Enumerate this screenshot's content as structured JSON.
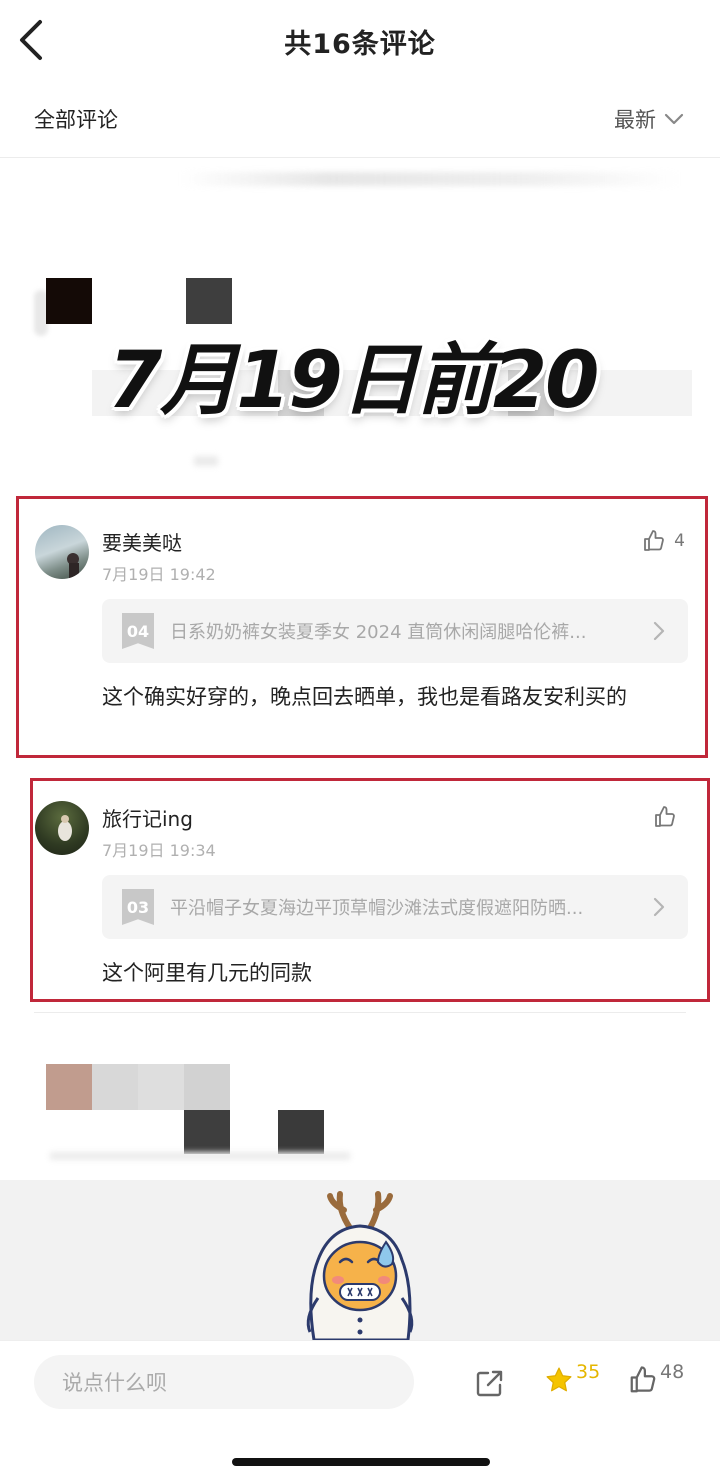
{
  "header": {
    "title": "共16条评论",
    "filter_label": "全部评论",
    "sort_label": "最新"
  },
  "overlay_stamp": "7月19日前20",
  "comments": [
    {
      "username": "要美美哒",
      "time": "7月19日 19:42",
      "likes": "4",
      "product_no": "04",
      "product_name": "日系奶奶裤女装夏季女 2024 直筒休闲阔腿哈伦裤...",
      "text": "这个确实好穿的，晚点回去晒单，我也是看路友安利买的"
    },
    {
      "username": "旅行记ing",
      "time": "7月19日 19:34",
      "likes": "",
      "product_no": "03",
      "product_name": "平沿帽子女夏海边平顶草帽沙滩法式度假遮阳防晒...",
      "text": "这个阿里有几元的同款"
    }
  ],
  "bottom_bar": {
    "input_placeholder": "说点什么呗",
    "star_count": "35",
    "like_count": "48"
  },
  "colors": {
    "highlight_border": "#c0283a",
    "star": "#f5c400",
    "mascot_face": "#f6b24a"
  },
  "icons": {
    "back": "back-arrow-icon",
    "sort": "chevron-down-icon",
    "like": "thumbs-up-icon",
    "share": "share-icon",
    "star": "star-icon",
    "chip_arrow": "chevron-right-icon"
  }
}
